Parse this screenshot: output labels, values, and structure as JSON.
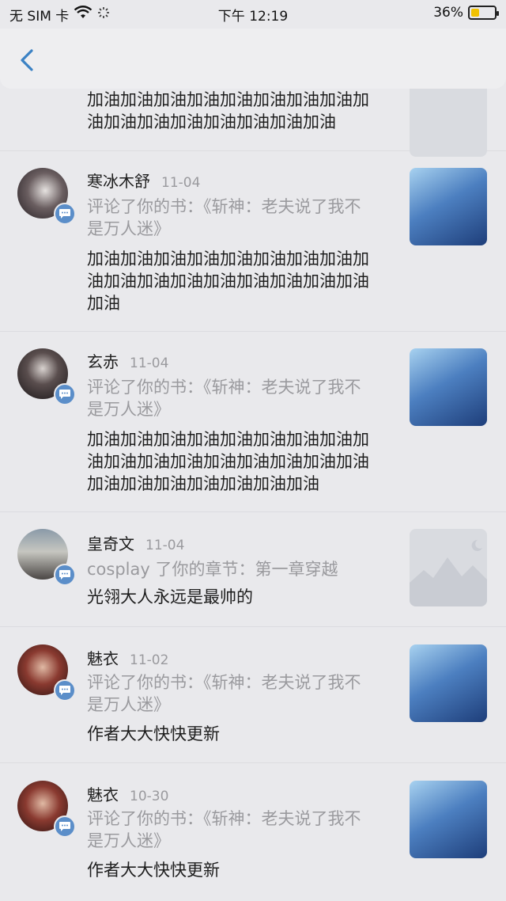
{
  "status_bar": {
    "carrier": "无 SIM 卡",
    "time": "下午 12:19",
    "battery": "36%"
  },
  "nav": {
    "back_label": ""
  },
  "notifications": [
    {
      "username": "",
      "date": "",
      "action": "",
      "comment": "加油加油加油加油加油加油加油加油加油加油加油加油加油加油加油加油",
      "thumb": "placeholder"
    },
    {
      "username": "寒冰木舒",
      "date": "11-04",
      "action": "评论了你的书：《斩神：老夫说了我不是万人迷》",
      "comment": "加油加油加油加油加油加油加油加油加油加油加油加油加油加油加油加油加油加油",
      "thumb": "cover"
    },
    {
      "username": "玄赤",
      "date": "11-04",
      "action": "评论了你的书：《斩神：老夫说了我不是万人迷》",
      "comment": "加油加油加油加油加油加油加油加油加油加油加油加油加油加油加油加油加油加油加油加油加油加油加油加油",
      "comment_display": "加油加油加油加油加油加油加油加油油加油加油加油加油加油加油加油加油加油加油加油加油加油加油加油…",
      "thumb": "cover"
    },
    {
      "username": "皇奇文",
      "date": "11-04",
      "action": "cosplay 了你的章节：第一章穿越",
      "comment": "光翎大人永远是最帅的",
      "thumb": "placeholder"
    },
    {
      "username": "魅衣",
      "date": "11-02",
      "action": "评论了你的书：《斩神：老夫说了我不是万人迷》",
      "comment": "作者大大快快更新",
      "thumb": "cover"
    },
    {
      "username": "魅衣",
      "date": "10-30",
      "action": "评论了你的书：《斩神：老夫说了我不是万人迷》",
      "comment": "作者大大快快更新",
      "thumb": "cover"
    }
  ]
}
